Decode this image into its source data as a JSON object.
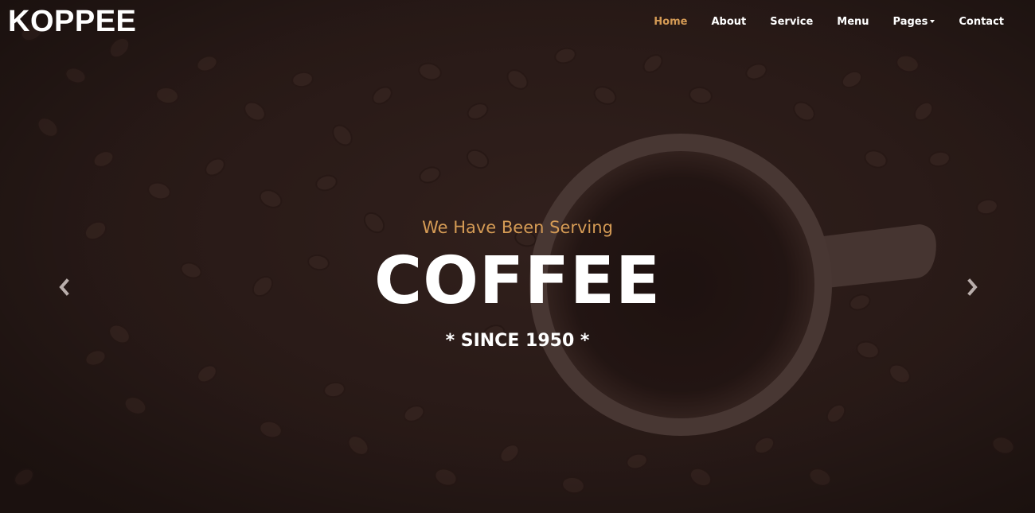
{
  "brand": {
    "name": "KOPPEE"
  },
  "nav": {
    "items": [
      {
        "label": "Home",
        "active": true
      },
      {
        "label": "About"
      },
      {
        "label": "Service"
      },
      {
        "label": "Menu"
      },
      {
        "label": "Pages",
        "dropdown": true
      },
      {
        "label": "Contact"
      }
    ]
  },
  "hero": {
    "kicker": "We Have Been Serving",
    "headline": "COFFEE",
    "sub": "* SINCE 1950 *"
  },
  "carousel": {
    "prev_icon": "chevron-left-icon",
    "next_icon": "chevron-right-icon"
  },
  "colors": {
    "accent": "#d59b55",
    "text": "#ffffff",
    "background": "#2b1d1a"
  }
}
